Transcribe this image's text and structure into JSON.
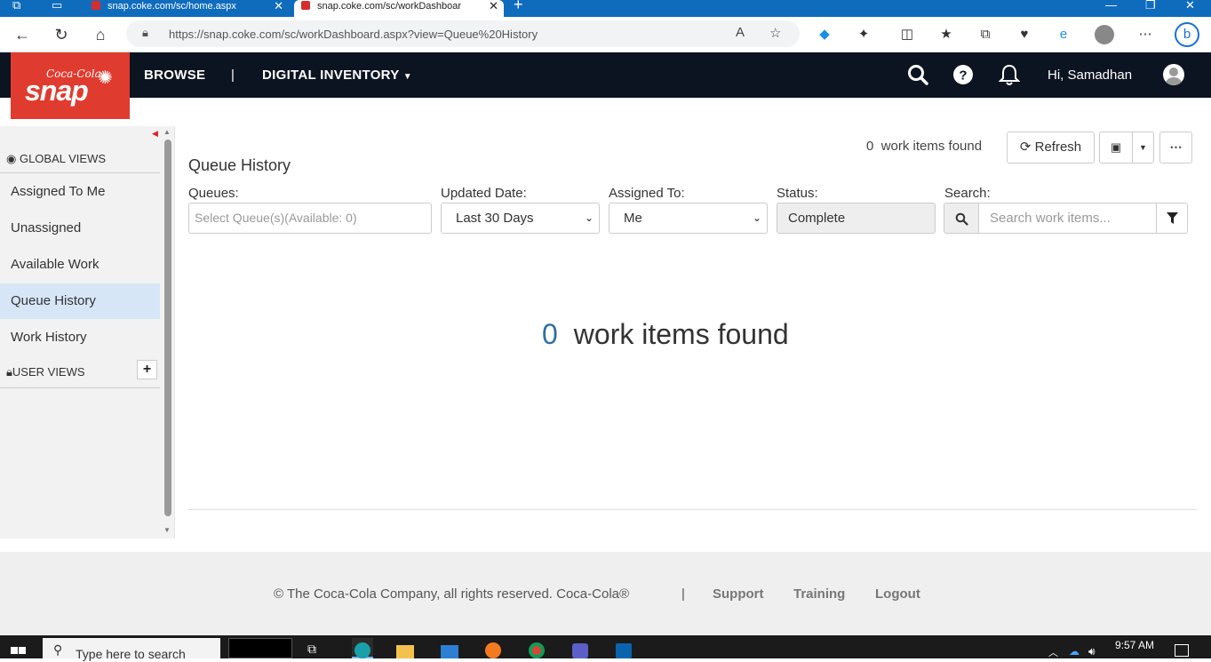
{
  "browser": {
    "tabs": [
      {
        "title": "snap.coke.com/sc/home.aspx"
      },
      {
        "title": "snap.coke.com/sc/workDashboar"
      }
    ],
    "url": "https://snap.coke.com/sc/workDashboard.aspx?view=Queue%20History"
  },
  "header": {
    "logo_brand": "Coca-Cola",
    "logo_text": "snap",
    "nav": {
      "browse": "BROWSE",
      "separator": "|",
      "digital_inventory": "DIGITAL INVENTORY"
    },
    "greeting": "Hi, Samadhan"
  },
  "sidebar": {
    "global_views_heading": "GLOBAL VIEWS",
    "items": [
      {
        "label": "Assigned To Me"
      },
      {
        "label": "Unassigned"
      },
      {
        "label": "Available Work"
      },
      {
        "label": "Queue History"
      },
      {
        "label": "Work History"
      }
    ],
    "active_item": "Queue History",
    "user_views_heading": "USER VIEWS",
    "add_label": "+"
  },
  "main": {
    "title": "Queue History",
    "count_top": "0",
    "count_top_label": "work items found",
    "refresh_label": "Refresh",
    "filters": {
      "queues": {
        "label": "Queues:",
        "placeholder": "Select Queue(s)(Available: 0)"
      },
      "updated": {
        "label": "Updated Date:",
        "value": "Last 30 Days"
      },
      "assigned": {
        "label": "Assigned To:",
        "value": "Me"
      },
      "status": {
        "label": "Status:",
        "value": "Complete"
      },
      "search": {
        "label": "Search:",
        "placeholder": "Search work items..."
      }
    },
    "empty_count": "0",
    "empty_label": "work items found"
  },
  "footer": {
    "copyright": "© The Coca-Cola Company, all rights reserved. Coca-Cola®",
    "separator": "|",
    "links": {
      "support": "Support",
      "training": "Training",
      "logout": "Logout"
    }
  },
  "taskbar": {
    "search_placeholder": "Type here to search",
    "time": "9:57 AM"
  }
}
